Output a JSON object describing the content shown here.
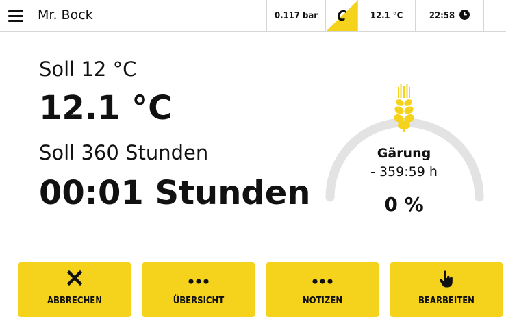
{
  "header": {
    "title": "Mr. Bock",
    "pressure": "0.117 bar",
    "mode": "C",
    "temperature": "12.1 °C",
    "time": "22:58"
  },
  "main": {
    "soll_temperature": "Soll 12 °C",
    "actual_temperature": "12.1 °C",
    "soll_duration": "Soll 360 Stunden",
    "actual_duration": "00:01 Stunden"
  },
  "gauge": {
    "phase": "Gärung",
    "remaining": "- 359:59 h",
    "percent": "0 %",
    "progress": 0,
    "track_color": "#e3e3e3",
    "icon": "wheat-icon",
    "icon_color": "#f5d31d"
  },
  "actions": {
    "cancel": {
      "label": "ABBRECHEN",
      "icon": "close-icon"
    },
    "overview": {
      "label": "ÜBERSICHT",
      "icon": "more-dots-icon"
    },
    "notes": {
      "label": "NOTIZEN",
      "icon": "more-dots-icon"
    },
    "edit": {
      "label": "BEARBEITEN",
      "icon": "pointer-hand-icon"
    }
  },
  "colors": {
    "accent": "#f5d31d",
    "text": "#111111",
    "divider": "#d6d6d6"
  }
}
